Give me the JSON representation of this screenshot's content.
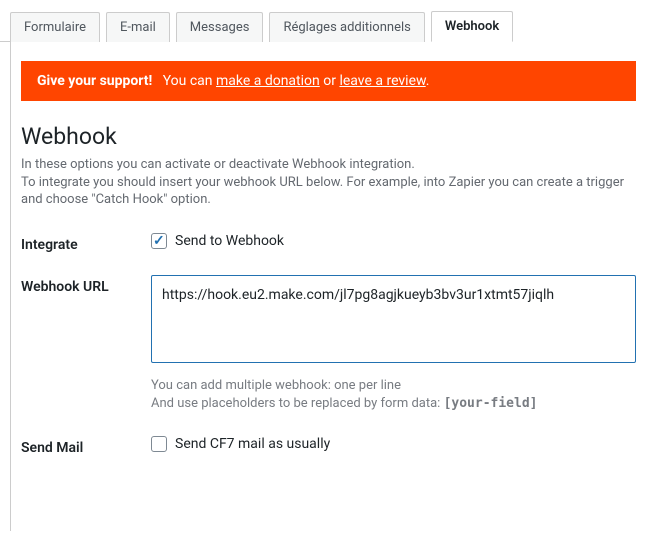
{
  "tabs": {
    "formulaire": "Formulaire",
    "email": "E-mail",
    "messages": "Messages",
    "reglages": "Réglages additionnels",
    "webhook": "Webhook"
  },
  "banner": {
    "strong": "Give your support!",
    "text1": "You can ",
    "link1": "make a donation",
    "text2": " or ",
    "link2": "leave a review",
    "text3": "."
  },
  "section": {
    "title": "Webhook",
    "desc": "In these options you can activate or deactivate Webhook integration.\nTo integrate you should insert your webhook URL below. For example, into Zapier you can create a trigger and choose \"Catch Hook\" option."
  },
  "fields": {
    "integrate": {
      "label": "Integrate",
      "checkbox_label": "Send to Webhook",
      "checked": true
    },
    "webhook_url": {
      "label": "Webhook URL",
      "value": "https://hook.eu2.make.com/jl7pg8agjkueyb3bv3ur1xtmt57jiqlh",
      "hint_line1": "You can add multiple webhook: one per line",
      "hint_line2_a": "And use placeholders to be replaced by form data: ",
      "hint_line2_b": "[your-field]"
    },
    "send_mail": {
      "label": "Send Mail",
      "checkbox_label": "Send CF7 mail as usually",
      "checked": false
    }
  }
}
